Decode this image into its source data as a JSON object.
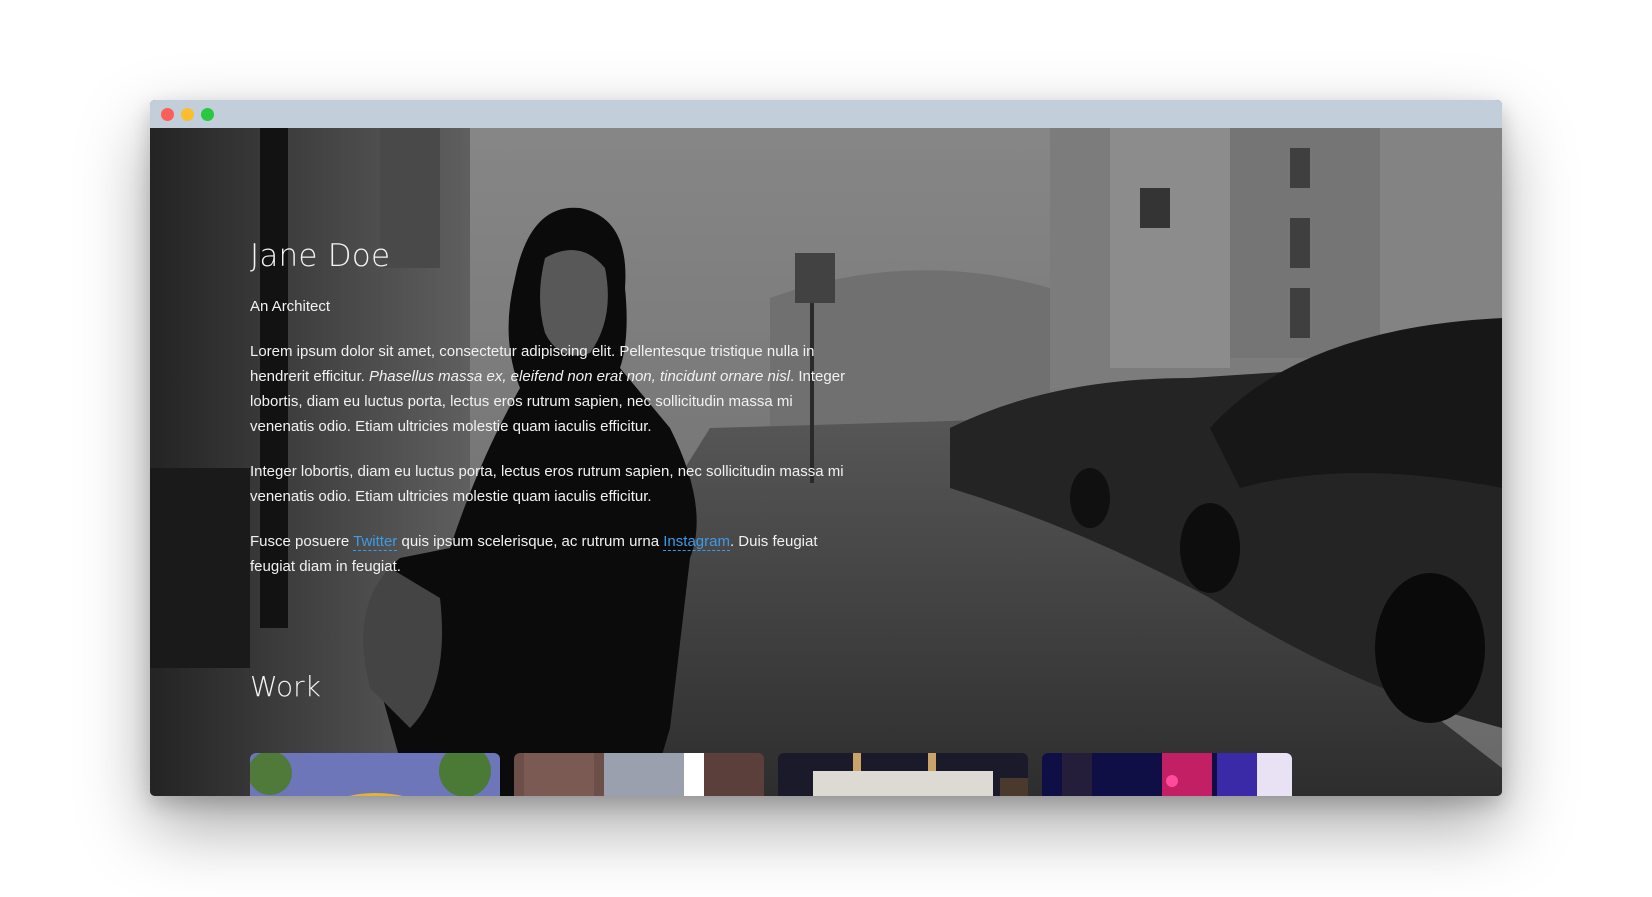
{
  "hero": {
    "name": "Jane Doe",
    "role": "An Architect",
    "para1_text": "Lorem ipsum dolor sit amet, consectetur adipiscing elit. Pellentesque tristique nulla in hendrerit efficitur. ",
    "para1_em": "Phasellus massa ex, eleifend non erat non, tincidunt ornare nisl",
    "para1_tail": ". Integer lobortis, diam eu luctus porta, lectus eros rutrum sapien, nec sollicitudin massa mi venenatis odio. Etiam ultricies molestie quam iaculis efficitur.",
    "para2": "Integer lobortis, diam eu luctus porta, lectus eros rutrum sapien, nec sollicitudin massa mi venenatis odio. Etiam ultricies molestie quam iaculis efficitur.",
    "para3_a": "Fusce posuere ",
    "link_twitter": "Twitter",
    "para3_b": " quis ipsum scelerisque, ac rutrum urna ",
    "link_instagram": "Instagram",
    "para3_c": ". Duis feugiat feugiat diam in feugiat."
  },
  "work": {
    "title": "Work",
    "thumbnails": [
      "architecture-dome",
      "city-towers",
      "concrete-interior",
      "neon-street"
    ]
  },
  "colors": {
    "link": "#3f9ae6",
    "titlebar": "#c2ced9",
    "overlay": "rgba(0,0,0,0.38)"
  },
  "window_controls": [
    "close-dot",
    "minimize-dot",
    "maximize-dot"
  ]
}
